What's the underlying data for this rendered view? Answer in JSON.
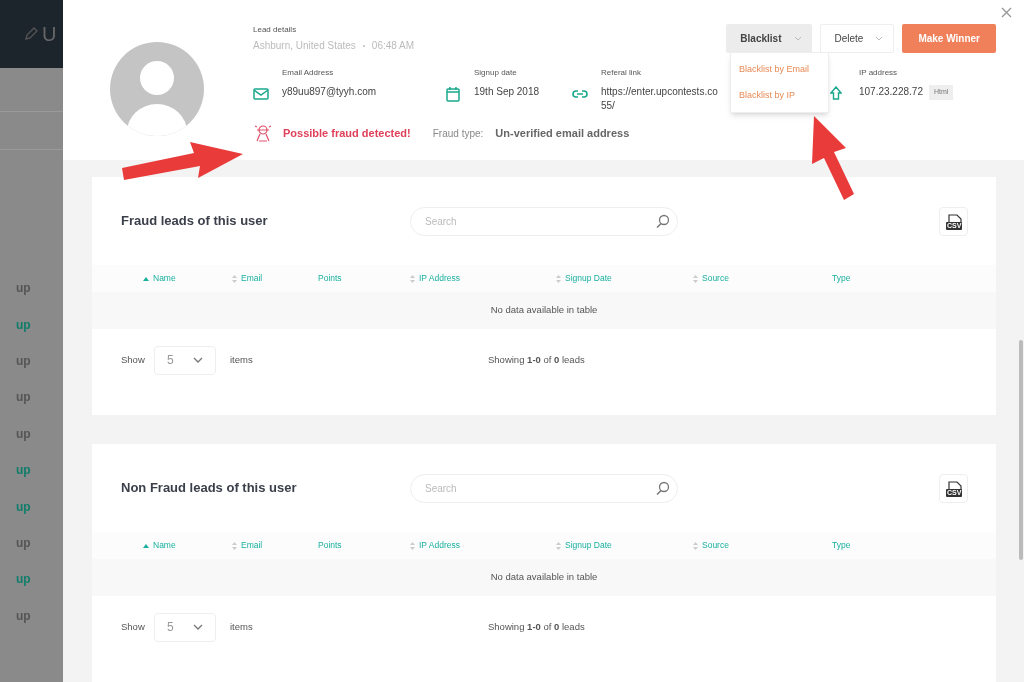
{
  "background_app": {
    "header_text": "U",
    "sidebar_items": [
      {
        "logo": "up",
        "highlighted": false
      },
      {
        "logo": "up",
        "highlighted": true
      },
      {
        "logo": "up",
        "highlighted": false
      },
      {
        "logo": "up",
        "highlighted": false
      },
      {
        "logo": "up",
        "highlighted": false
      },
      {
        "logo": "up",
        "highlighted": true
      },
      {
        "logo": "up",
        "highlighted": true
      },
      {
        "logo": "up",
        "highlighted": false
      },
      {
        "logo": "up",
        "highlighted": true
      },
      {
        "logo": "up",
        "highlighted": false
      }
    ]
  },
  "lead": {
    "heading": "Lead details",
    "location": "Ashburn, United States",
    "time": "06:48 AM",
    "fields": [
      {
        "kind": "email",
        "label": "Email Address",
        "value": "y89uu897@tyyh.com"
      },
      {
        "kind": "date",
        "label": "Signup date",
        "value": "19th Sep 2018"
      },
      {
        "kind": "link",
        "label": "Referal link",
        "value": "https://enter.upcontests.co\n55/"
      },
      {
        "kind": "ip",
        "label": "IP address",
        "value": "107.23.228.72",
        "tag": "Html"
      }
    ],
    "fraud_alert": "Possible fraud detected!",
    "fraud_type_label": "Fraud type:",
    "fraud_type": "Un-verified email address"
  },
  "actions": [
    {
      "kind": "dropdown",
      "label": "Blacklist",
      "open": true
    },
    {
      "kind": "dropdown",
      "label": "Delete",
      "open": false
    },
    {
      "kind": "primary",
      "label": "Make Winner"
    }
  ],
  "blacklist_menu": [
    "Blacklist by Email",
    "Blacklist by IP"
  ],
  "tables": [
    {
      "title": "Fraud leads of this user",
      "search_placeholder": "Search",
      "export": "CSV",
      "columns": [
        {
          "label": "Name",
          "sortable": true,
          "sorted": true
        },
        {
          "label": "Email",
          "sortable": true,
          "sorted": false
        },
        {
          "label": "Points",
          "sortable": false,
          "sorted": false
        },
        {
          "label": "IP Address",
          "sortable": true,
          "sorted": false
        },
        {
          "label": "Signup Date",
          "sortable": true,
          "sorted": false
        },
        {
          "label": "Source",
          "sortable": true,
          "sorted": false
        },
        {
          "label": "Type",
          "sortable": false,
          "sorted": false
        }
      ],
      "empty_message": "No data available in table",
      "show_label": "Show",
      "page_size": "5",
      "items_label": "items",
      "summary": "Showing **1-0** of **0** leads"
    },
    {
      "title": "Non Fraud leads of this user",
      "search_placeholder": "Search",
      "export": "CSV",
      "columns": [
        {
          "label": "Name",
          "sortable": true,
          "sorted": true
        },
        {
          "label": "Email",
          "sortable": true,
          "sorted": false
        },
        {
          "label": "Points",
          "sortable": false,
          "sorted": false
        },
        {
          "label": "IP Address",
          "sortable": true,
          "sorted": false
        },
        {
          "label": "Signup Date",
          "sortable": true,
          "sorted": false
        },
        {
          "label": "Source",
          "sortable": true,
          "sorted": false
        },
        {
          "label": "Type",
          "sortable": false,
          "sorted": false
        }
      ],
      "empty_message": "No data available in table",
      "show_label": "Show",
      "page_size": "5",
      "items_label": "items",
      "summary": "Showing **1-0** of **0** leads"
    }
  ]
}
